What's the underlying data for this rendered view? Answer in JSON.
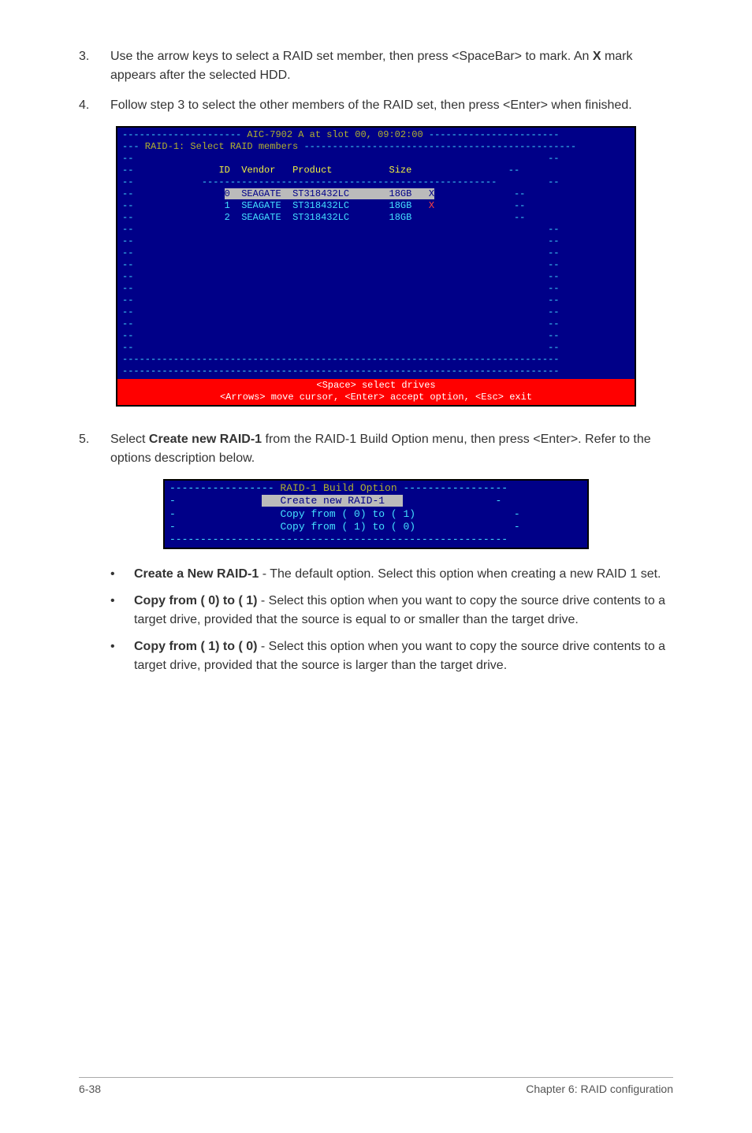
{
  "step3": {
    "num": "3.",
    "text_a": "Use the arrow keys to select a RAID set member, then press <SpaceBar> to mark. An ",
    "text_b": "X",
    "text_c": " mark appears after the selected HDD."
  },
  "step4": {
    "num": "4.",
    "text": "Follow step 3 to select the other members of the RAID set, then press <Enter> when finished."
  },
  "bios1": {
    "topline_a": "---------------------",
    "topline_b": " AIC-7902 A at slot 00, 09:02:00 ",
    "topline_c": "-----------------------",
    "subline_a": "---",
    "subline_b": " RAID-1: Select RAID members ",
    "subline_c": "------------------------------------------------",
    "heading_id": "ID",
    "heading_vendor": "Vendor",
    "heading_product": "Product",
    "heading_size": "Size",
    "rows": [
      {
        "id": "0",
        "vendor": "SEAGATE",
        "product": "ST318432LC",
        "size": "18GB",
        "mark": "X"
      },
      {
        "id": "1",
        "vendor": "SEAGATE",
        "product": "ST318432LC",
        "size": "18GB",
        "mark": "X"
      },
      {
        "id": "2",
        "vendor": "SEAGATE",
        "product": "ST318432LC",
        "size": "18GB",
        "mark": ""
      }
    ],
    "footer_a": "<Space> select drives",
    "footer_b": "<Arrows> move cursor, <Enter> accept option, <Esc> exit"
  },
  "step5": {
    "num": "5.",
    "text_a": "Select ",
    "text_b": "Create new RAID-1",
    "text_c": " from the RAID-1 Build Option menu, then press <Enter>. Refer to the options description below."
  },
  "bios2": {
    "title_a": "-----------------",
    "title_b": " RAID-1 Build Option ",
    "title_c": "-----------------",
    "opt1": "Create new RAID-1",
    "opt2": "Copy from ( 0) to ( 1)",
    "opt3": "Copy from ( 1) to ( 0)",
    "bottom": "-------------------------------------------------------"
  },
  "bullets": [
    {
      "bold": "Create a New RAID-1",
      "text": " - The default option. Select this option when creating a new RAID 1 set."
    },
    {
      "bold": "Copy from ( 0) to ( 1)",
      "text": " - Select this option when you want to copy the source drive contents to a target drive, provided that the source is equal to or smaller than the target drive."
    },
    {
      "bold": "Copy from ( 1) to ( 0)",
      "text": " - Select this option when you want to copy the source drive contents to a target drive, provided that the source is larger than the target drive."
    }
  ],
  "footer": {
    "left": "6-38",
    "right": "Chapter 6: RAID configuration"
  }
}
